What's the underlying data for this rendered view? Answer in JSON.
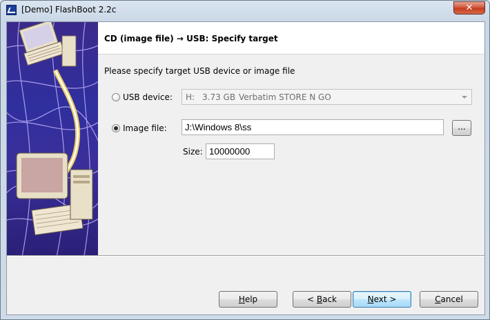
{
  "window": {
    "title": "[Demo] FlashBoot 2.2c",
    "close_label": "✕"
  },
  "header": {
    "title": "CD (image file) → USB: Specify target"
  },
  "instruction": "Please specify target USB device or image file",
  "usb_device": {
    "label": "USB device:",
    "drive": "H:",
    "size": "3.73 GB",
    "name": "Verbatim STORE N GO",
    "selected": false
  },
  "image_file": {
    "label": "Image file:",
    "path": "J:\\Windows 8\\ss",
    "browse_label": "...",
    "selected": true
  },
  "size": {
    "label": "Size:",
    "value": "10000000"
  },
  "buttons": {
    "help": {
      "mnemonic": "H",
      "rest": "elp"
    },
    "back": {
      "prefix": "< ",
      "mnemonic": "B",
      "rest": "ack"
    },
    "next": {
      "mnemonic": "N",
      "rest": "ext >"
    },
    "cancel": {
      "mnemonic": "C",
      "rest": "ancel"
    }
  },
  "colors": {
    "banner": "#2f2f9e",
    "close": "#c43c1d",
    "default_button": "#3c7fb1"
  }
}
